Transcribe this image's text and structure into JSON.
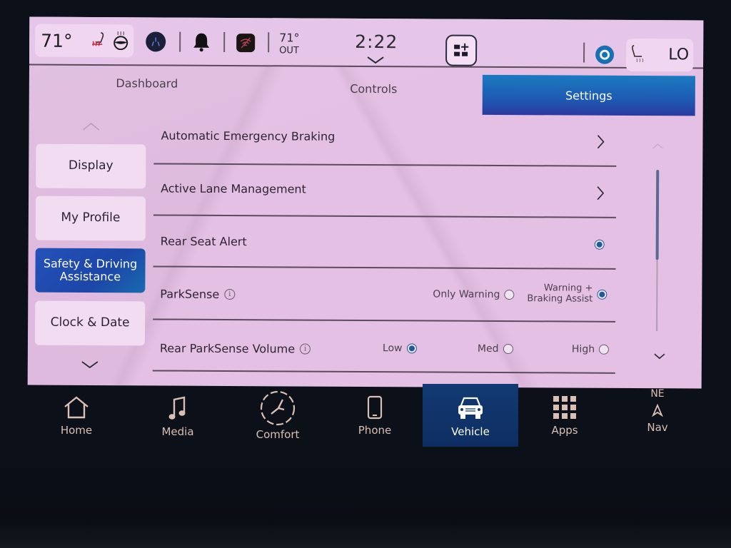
{
  "status_bar": {
    "driver_temp": "71°",
    "outside_temp": "71°",
    "outside_label": "OUT",
    "time": "2:22",
    "passenger_temp": "LO",
    "icons": [
      "heated-seat-icon",
      "heated-steering-wheel-icon",
      "driver-assist-icon",
      "bell-icon",
      "wifi-off-icon",
      "widgets-add-icon",
      "alexa-icon",
      "passenger-seat-icon"
    ]
  },
  "tabs": [
    {
      "label": "Dashboard",
      "active": false
    },
    {
      "label": "Controls",
      "active": false
    },
    {
      "label": "Settings",
      "active": true
    }
  ],
  "sidebar": {
    "items": [
      {
        "label": "Display",
        "active": false
      },
      {
        "label": "My Profile",
        "active": false
      },
      {
        "label": "Safety & Driving Assistance",
        "active": true
      },
      {
        "label": "Clock & Date",
        "active": false
      }
    ]
  },
  "settings": {
    "rows": [
      {
        "label": "Automatic Emergency Braking",
        "type": "link"
      },
      {
        "label": "Active Lane Management",
        "type": "link"
      },
      {
        "label": "Rear Seat Alert",
        "type": "toggle",
        "checked": true
      },
      {
        "label": "ParkSense",
        "type": "radio",
        "info": true,
        "options": [
          {
            "label": "Only Warning",
            "selected": false
          },
          {
            "label_line1": "Warning +",
            "label_line2": "Braking Assist",
            "selected": true
          }
        ]
      },
      {
        "label": "Rear ParkSense Volume",
        "type": "radio",
        "info": true,
        "options": [
          {
            "label": "Low",
            "selected": true
          },
          {
            "label": "Med",
            "selected": false
          },
          {
            "label": "High",
            "selected": false
          }
        ]
      }
    ],
    "scroll_position_fraction": 0.0
  },
  "bottom_nav": {
    "items": [
      {
        "label": "Home",
        "active": false
      },
      {
        "label": "Media",
        "active": false
      },
      {
        "label": "Comfort",
        "active": false
      },
      {
        "label": "Phone",
        "active": false
      },
      {
        "label": "Vehicle",
        "active": true
      },
      {
        "label": "Apps",
        "active": false
      },
      {
        "label": "Nav",
        "active": false,
        "heading": "NE"
      }
    ]
  },
  "colors": {
    "accent_blue": "#1e5ab2",
    "screen_bg": "#e4c0e4",
    "nav_active": "#123a72",
    "nav_text": "#d9bfb4"
  }
}
